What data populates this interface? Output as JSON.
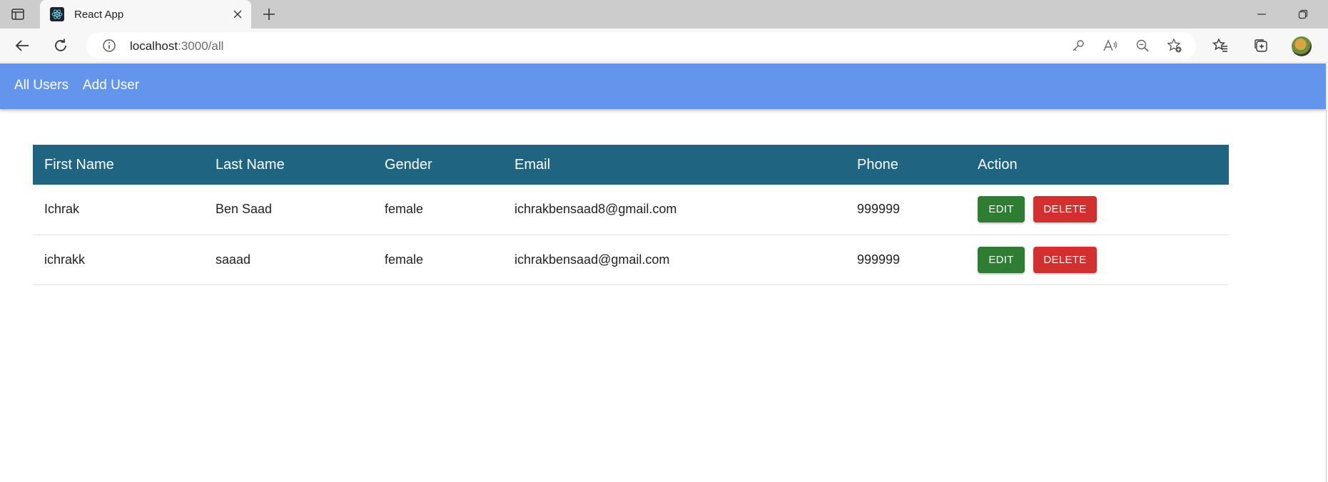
{
  "browser": {
    "tab_title": "React App",
    "url_host": "localhost",
    "url_path": ":3000/all"
  },
  "nav": {
    "items": [
      {
        "label": "All Users"
      },
      {
        "label": "Add User"
      }
    ]
  },
  "table": {
    "headers": [
      "First Name",
      "Last Name",
      "Gender",
      "Email",
      "Phone",
      "Action"
    ],
    "rows": [
      {
        "first_name": "Ichrak",
        "last_name": "Ben Saad",
        "gender": "female",
        "email": "ichrakbensaad8@gmail.com",
        "phone": "999999",
        "edit_label": "EDIT",
        "delete_label": "DELETE"
      },
      {
        "first_name": "ichrakk",
        "last_name": "saaad",
        "gender": "female",
        "email": "ichrakbensaad@gmail.com",
        "phone": "999999",
        "edit_label": "EDIT",
        "delete_label": "DELETE"
      }
    ]
  },
  "colors": {
    "appbar": "#6495ed",
    "table_header": "#1f6480",
    "edit_button": "#2e7d32",
    "delete_button": "#d32f2f"
  },
  "icons": [
    "sidebar-toggle-icon",
    "react-logo-icon",
    "close-icon",
    "plus-icon",
    "minimize-icon",
    "restore-icon",
    "back-icon",
    "refresh-icon",
    "info-icon",
    "key-icon",
    "read-aloud-icon",
    "zoom-out-icon",
    "add-favorite-icon",
    "favorites-icon",
    "collections-icon"
  ]
}
